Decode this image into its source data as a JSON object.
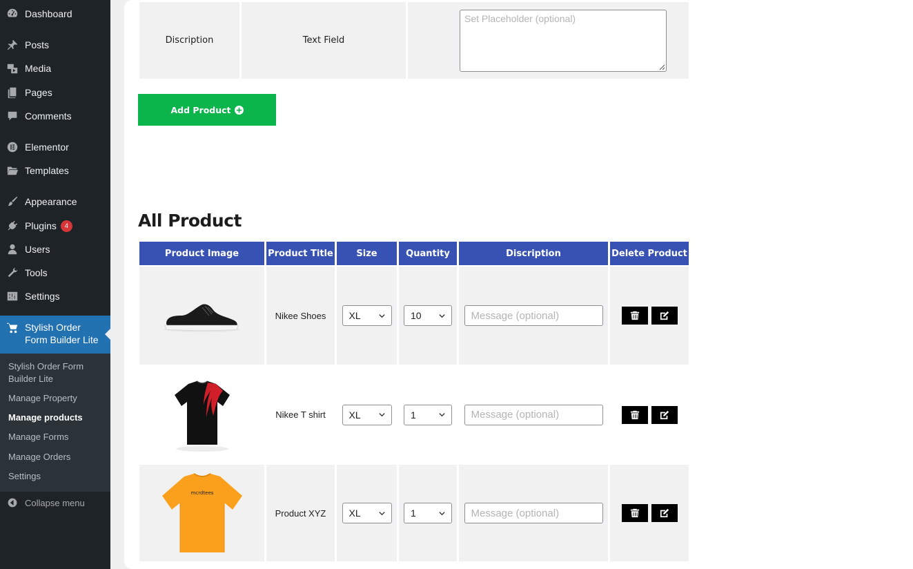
{
  "sidebar": {
    "items": [
      {
        "label": "Dashboard",
        "icon": "dashboard-icon"
      },
      {
        "label": "Posts",
        "icon": "pushpin-icon"
      },
      {
        "label": "Media",
        "icon": "media-icon"
      },
      {
        "label": "Pages",
        "icon": "pages-icon"
      },
      {
        "label": "Comments",
        "icon": "comment-icon"
      },
      {
        "label": "Elementor",
        "icon": "elementor-icon"
      },
      {
        "label": "Templates",
        "icon": "folder-icon"
      },
      {
        "label": "Appearance",
        "icon": "brush-icon"
      },
      {
        "label": "Plugins",
        "icon": "plugin-icon",
        "badge": "4"
      },
      {
        "label": "Users",
        "icon": "user-icon"
      },
      {
        "label": "Tools",
        "icon": "wrench-icon"
      },
      {
        "label": "Settings",
        "icon": "sliders-icon"
      }
    ],
    "active": {
      "label_line1": "Stylish Order",
      "label_line2": "Form Builder Lite",
      "icon": "cart-icon"
    },
    "submenu": [
      {
        "label_line1": "Stylish Order Form",
        "label_line2": "Builder Lite"
      },
      {
        "label": "Manage Property"
      },
      {
        "label": "Manage products"
      },
      {
        "label": "Manage Forms"
      },
      {
        "label": "Manage Orders"
      },
      {
        "label": "Settings"
      }
    ],
    "collapse_label": "Collapse menu"
  },
  "top_row": {
    "name": "Discription",
    "type": "Text Field",
    "placeholder": "Set Placeholder (optional)"
  },
  "add_button_label": "Add Product",
  "heading": "All Product",
  "table": {
    "headers": [
      "Product Image",
      "Product Title",
      "Size",
      "Quantity",
      "Discription",
      "Delete Product"
    ],
    "rows": [
      {
        "title": "Nikee Shoes",
        "size": "XL",
        "quantity": "10",
        "message_placeholder": "Message (optional)",
        "image": "black-sneaker"
      },
      {
        "title": "Nikee T shirt",
        "size": "XL",
        "quantity": "1",
        "message_placeholder": "Message (optional)",
        "image": "black-red-tshirt"
      },
      {
        "title": "Product XYZ",
        "size": "XL",
        "quantity": "1",
        "message_placeholder": "Message (optional)",
        "image": "orange-tshirt",
        "shirt_text": "mcrdtees"
      }
    ]
  },
  "colors": {
    "sidebar_bg": "#1d2327",
    "active_menu": "#2271b1",
    "header_blue": "#3852b4",
    "add_green": "#0cb44c",
    "badge_red": "#d63638"
  }
}
